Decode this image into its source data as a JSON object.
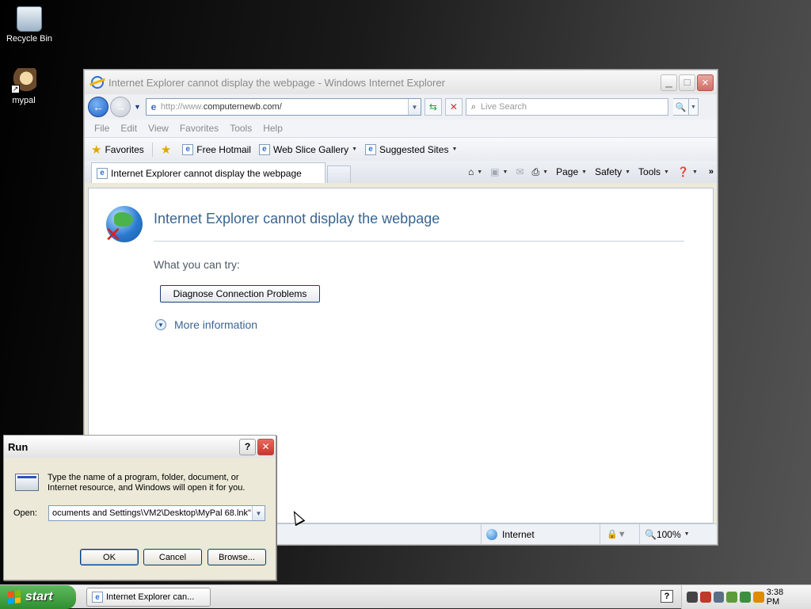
{
  "desktop": {
    "icons": [
      {
        "label": "Recycle Bin",
        "icon": "recycle-bin-icon"
      },
      {
        "label": "mypal",
        "icon": "mypal-icon"
      }
    ]
  },
  "browser": {
    "title": "Internet Explorer cannot display the webpage - Windows Internet Explorer",
    "address_prefix": "http://www.",
    "address_domain": "computernewb.com/",
    "search_placeholder": "Live Search",
    "menu": [
      "File",
      "Edit",
      "View",
      "Favorites",
      "Tools",
      "Help"
    ],
    "favorites_bar": {
      "favorites_label": "Favorites",
      "items": [
        {
          "label": "Free Hotmail",
          "dropdown": false
        },
        {
          "label": "Web Slice Gallery",
          "dropdown": true
        },
        {
          "label": "Suggested Sites",
          "dropdown": true
        }
      ]
    },
    "tab": {
      "label": "Internet Explorer cannot display the webpage"
    },
    "commandbar": {
      "page": "Page",
      "safety": "Safety",
      "tools": "Tools"
    },
    "content": {
      "title": "Internet Explorer cannot display the webpage",
      "try_label": "What you can try:",
      "diagnose_button": "Diagnose Connection Problems",
      "more_info": "More information"
    },
    "status": {
      "zone": "Internet",
      "zoom": "100%"
    }
  },
  "run_dialog": {
    "title": "Run",
    "help_glyph": "?",
    "description": "Type the name of a program, folder, document, or Internet resource, and Windows will open it for you.",
    "open_label": "Open:",
    "open_value": "ocuments and Settings\\VM2\\Desktop\\MyPal 68.lnk\"",
    "ok_label": "OK",
    "cancel_label": "Cancel",
    "browse_label": "Browse..."
  },
  "taskbar": {
    "start_label": "start",
    "task_label": "Internet Explorer can...",
    "clock": "3:38 PM"
  }
}
